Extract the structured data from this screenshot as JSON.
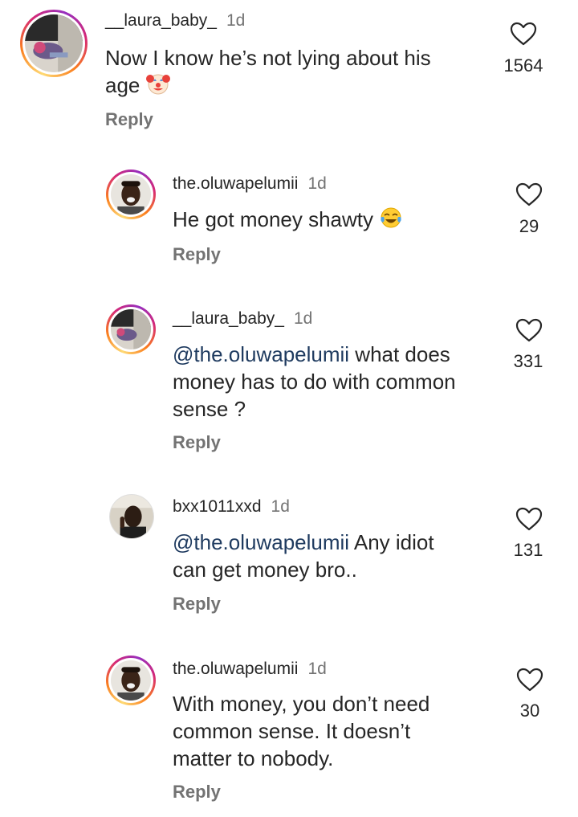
{
  "comments": [
    {
      "username": "__laura_baby_",
      "time": "1d",
      "mention": "",
      "text_lines": [
        "Now I know he’s not lying about his",
        "age"
      ],
      "emoji": "clown-face",
      "likes": "1564",
      "reply_label": "Reply"
    },
    {
      "username": "the.oluwapelumii",
      "time": "1d",
      "mention": "",
      "text_lines": [
        "He got money shawty"
      ],
      "emoji": "tears-of-joy-face",
      "likes": "29",
      "reply_label": "Reply"
    },
    {
      "username": "__laura_baby_",
      "time": "1d",
      "mention": "@the.oluwapelumii",
      "text_lines": [
        " what does",
        "money has to do with common",
        "sense ?"
      ],
      "likes": "331",
      "reply_label": "Reply"
    },
    {
      "username": "bxx1011xxd",
      "time": "1d",
      "mention": "@the.oluwapelumii",
      "text_lines": [
        " Any idiot",
        "can get money bro.."
      ],
      "likes": "131",
      "reply_label": "Reply"
    },
    {
      "username": "the.oluwapelumii",
      "time": "1d",
      "mention": "",
      "text_lines": [
        "With money, you don’t need",
        "common sense. It doesn’t",
        "matter to nobody."
      ],
      "likes": "30",
      "reply_label": "Reply"
    }
  ],
  "icons": {
    "like": "heart-outline-icon"
  },
  "colors": {
    "mention": "#1e3a5f",
    "meta": "#737373",
    "text": "#262626"
  }
}
